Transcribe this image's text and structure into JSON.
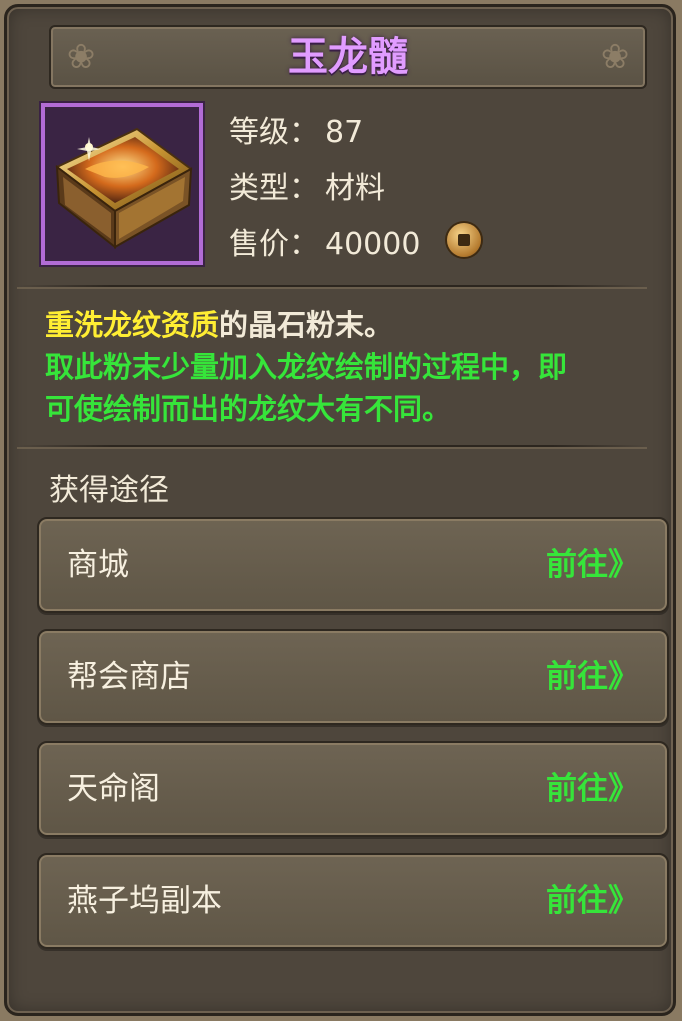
{
  "item": {
    "name": "玉龙髓",
    "level_label": "等级：",
    "level": "87",
    "type_label": "类型：",
    "type": "材料",
    "price_label": "售价：",
    "price": "40000",
    "icon": "treasure-chest-icon",
    "name_color": "#e19cff"
  },
  "description": {
    "highlight": "重洗龙纹资质",
    "line1_rest": "的晶石粉末。",
    "line2": "取此粉末少量加入龙纹绘制的过程中，即",
    "line3": "可使绘制而出的龙纹大有不同。"
  },
  "sources": {
    "title": "获得途径",
    "items": [
      {
        "name": "商城",
        "action": "前往》"
      },
      {
        "name": "帮会商店",
        "action": "前往》"
      },
      {
        "name": "天命阁",
        "action": "前往》"
      },
      {
        "name": "燕子坞副本",
        "action": "前往》"
      }
    ]
  }
}
